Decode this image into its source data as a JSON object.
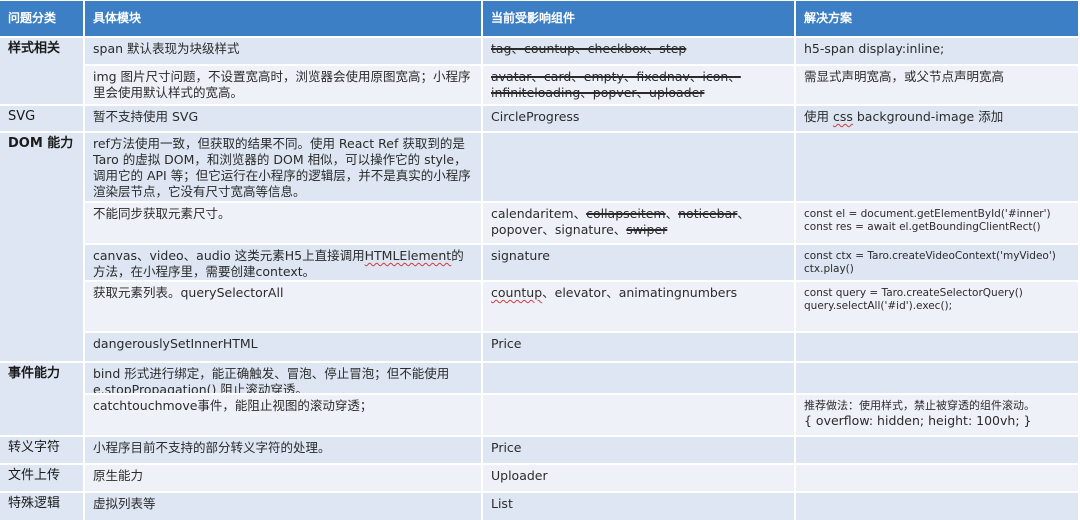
{
  "header": {
    "col1": "问题分类",
    "col2": "具体模块",
    "col3": "当前受影响组件",
    "col4": "解决方案"
  },
  "rows": [
    {
      "category": "样式相关",
      "module": "span 默认表现为块级样式",
      "components": "tag、countup、checkbox、step",
      "solution": "h5-span display:inline;"
    },
    {
      "category": "",
      "module": "img 图片尺寸问题，不设置宽高时，浏览器会使用原图宽高；小程序里会使用默认样式的宽高。",
      "components": "avatar、card、empty、fixednav、icon、infiniteloading、popver、uploader",
      "solution": "需显式声明宽高，或父节点声明宽高"
    },
    {
      "category": "SVG",
      "module": "暂不支持使用 SVG",
      "components": "CircleProgress",
      "solution_a": "使用 ",
      "solution_b": "css",
      "solution_c": " background-image 添加"
    },
    {
      "category": "DOM 能力",
      "module": "ref方法使用一致，但获取的结果不同。使用 React Ref 获取到的是 Taro 的虚拟 DOM，和浏览器的 DOM 相似，可以操作它的 style，调用它的 API 等；但它运行在小程序的逻辑层，并不是真实的小程序渲染层节点，它没有尺寸宽高等信息。",
      "components": "",
      "solution": ""
    },
    {
      "category": "",
      "module": "不能同步获取元素尺寸。",
      "components_a": "calendaritem、",
      "components_b": "collapseitem",
      "components_c": "、",
      "components_d": "noticebar",
      "components_e": "、popover、signature、",
      "components_f": "swiper",
      "solution_line1": "const el = document.getElementById('#inner')",
      "solution_line2": "const res = await el.getBoundingClientRect()"
    },
    {
      "category": "",
      "module_a": "canvas、video、audio 这类元素H5上直接调用",
      "module_b": "HTMLElement",
      "module_c": "的方法，在小程序里，需要创建context。",
      "components": "signature",
      "solution_line1": "const ctx = Taro.createVideoContext('myVideo')",
      "solution_line2": "ctx.play()"
    },
    {
      "category": "",
      "module": "获取元素列表。querySelectorAll",
      "components_a": "countup",
      "components_b": "、elevator、animatingnumbers",
      "solution_line1": "const query = Taro.createSelectorQuery()",
      "solution_line2": "query.selectAll('#id').exec();"
    },
    {
      "category": "",
      "module": "dangerouslySetInnerHTML",
      "components": "Price",
      "solution": ""
    },
    {
      "category": "事件能力",
      "module": "bind 形式进行绑定，能正确触发、冒泡、停止冒泡；但不能使用 e.stopPropagation() 阻止滚动穿透。",
      "components": "",
      "solution": ""
    },
    {
      "category": "",
      "module": "catchtouchmove事件，能阻止视图的滚动穿透；",
      "components": "",
      "solution_line1": "推荐做法：使用样式，禁止被穿透的组件滚动。",
      "solution_line2": "{ overflow: hidden; height: 100vh; }"
    },
    {
      "category": "转义字符",
      "module": "小程序目前不支持的部分转义字符的处理。",
      "components": "Price",
      "solution": ""
    },
    {
      "category": "文件上传",
      "module": "原生能力",
      "components": "Uploader",
      "solution": ""
    },
    {
      "category": "特殊逻辑",
      "module": "虚拟列表等",
      "components": "List",
      "solution": ""
    }
  ],
  "colors": {
    "header_bg": "#3d7fc4",
    "row_bg": "#dde6f2",
    "alt_bg": "#eef2f8"
  }
}
